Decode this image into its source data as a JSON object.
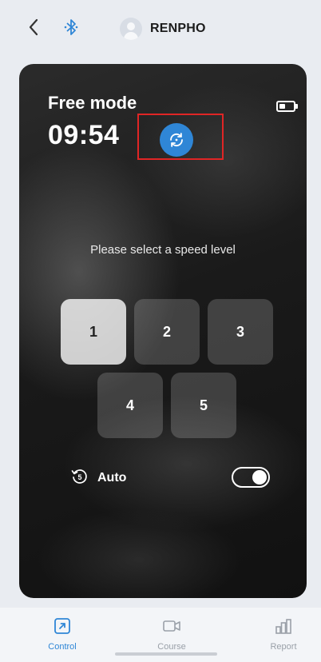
{
  "header": {
    "brand_name": "RENPHO"
  },
  "session": {
    "mode": "Free mode",
    "timer": "09:54",
    "prompt": "Please select a speed level",
    "auto_label": "Auto",
    "auto_enabled": true
  },
  "speed_levels": [
    {
      "label": "1",
      "selected": true
    },
    {
      "label": "2",
      "selected": false
    },
    {
      "label": "3",
      "selected": false
    },
    {
      "label": "4",
      "selected": false
    },
    {
      "label": "5",
      "selected": false
    }
  ],
  "bottom_nav": [
    {
      "label": "Control",
      "icon": "control-icon",
      "active": true
    },
    {
      "label": "Course",
      "icon": "video-icon",
      "active": false
    },
    {
      "label": "Report",
      "icon": "bar-chart-icon",
      "active": false
    }
  ],
  "colors": {
    "accent": "#2f86d6",
    "highlight_box": "#e02525"
  },
  "icons": {
    "back": "back-chevron-icon",
    "bluetooth": "bluetooth-icon",
    "battery": "battery-icon",
    "sync": "sync-icon",
    "auto": "auto-timer-icon"
  }
}
